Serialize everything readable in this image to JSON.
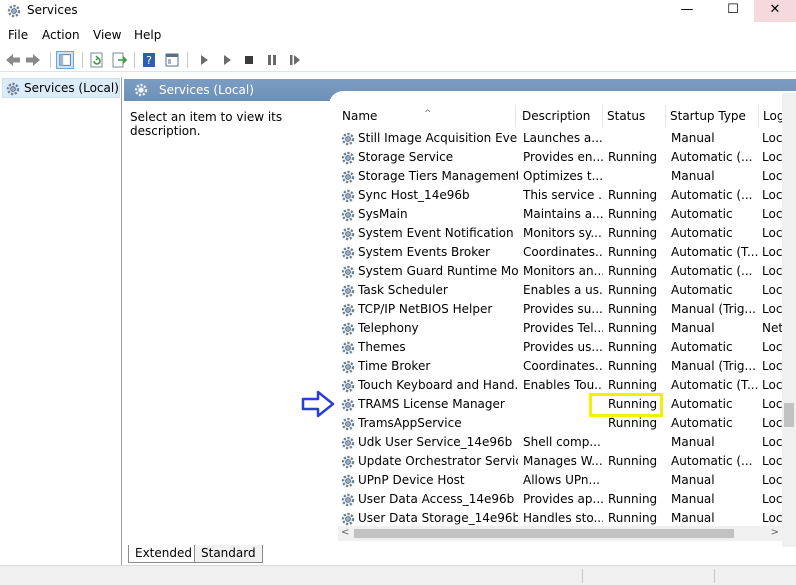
{
  "window": {
    "title": "Services",
    "minimize": "—",
    "maximize": "☐",
    "close": "✕"
  },
  "menu": [
    "File",
    "Action",
    "View",
    "Help"
  ],
  "tree": {
    "root": "Services (Local)"
  },
  "panel": {
    "title": "Services (Local)",
    "description_hint": "Select an item to view its description."
  },
  "columns": {
    "name": "Name",
    "description": "Description",
    "status": "Status",
    "startup": "Startup Type",
    "logon": "Log"
  },
  "services": [
    {
      "name": "Still Image Acquisition Events",
      "description": "Launches a...",
      "status": "",
      "startup": "Manual",
      "logon": "Loca"
    },
    {
      "name": "Storage Service",
      "description": "Provides en...",
      "status": "Running",
      "startup": "Automatic (...",
      "logon": "Loca"
    },
    {
      "name": "Storage Tiers Management",
      "description": "Optimizes t...",
      "status": "",
      "startup": "Manual",
      "logon": "Loca"
    },
    {
      "name": "Sync Host_14e96b",
      "description": "This service ...",
      "status": "Running",
      "startup": "Automatic (...",
      "logon": "Loca"
    },
    {
      "name": "SysMain",
      "description": "Maintains a...",
      "status": "Running",
      "startup": "Automatic",
      "logon": "Loca"
    },
    {
      "name": "System Event Notification S...",
      "description": "Monitors sy...",
      "status": "Running",
      "startup": "Automatic",
      "logon": "Loca"
    },
    {
      "name": "System Events Broker",
      "description": "Coordinates...",
      "status": "Running",
      "startup": "Automatic (T...",
      "logon": "Loca"
    },
    {
      "name": "System Guard Runtime Mo...",
      "description": "Monitors an...",
      "status": "Running",
      "startup": "Automatic (...",
      "logon": "Loca"
    },
    {
      "name": "Task Scheduler",
      "description": "Enables a us...",
      "status": "Running",
      "startup": "Automatic",
      "logon": "Loca"
    },
    {
      "name": "TCP/IP NetBIOS Helper",
      "description": "Provides su...",
      "status": "Running",
      "startup": "Manual (Trig...",
      "logon": "Loca"
    },
    {
      "name": "Telephony",
      "description": "Provides Tel...",
      "status": "Running",
      "startup": "Manual",
      "logon": "Netw"
    },
    {
      "name": "Themes",
      "description": "Provides us...",
      "status": "Running",
      "startup": "Automatic",
      "logon": "Loca"
    },
    {
      "name": "Time Broker",
      "description": "Coordinates...",
      "status": "Running",
      "startup": "Manual (Trig...",
      "logon": "Loca"
    },
    {
      "name": "Touch Keyboard and Hand...",
      "description": "Enables Tou...",
      "status": "Running",
      "startup": "Automatic (T...",
      "logon": "Loca"
    },
    {
      "name": "TRAMS License Manager",
      "description": "",
      "status": "Running",
      "startup": "Automatic",
      "logon": "Loca"
    },
    {
      "name": "TramsAppService",
      "description": "",
      "status": "Running",
      "startup": "Automatic",
      "logon": "Loca"
    },
    {
      "name": "Udk User Service_14e96b",
      "description": "Shell comp...",
      "status": "",
      "startup": "Manual",
      "logon": "Loca"
    },
    {
      "name": "Update Orchestrator Service",
      "description": "Manages W...",
      "status": "Running",
      "startup": "Automatic (...",
      "logon": "Loca"
    },
    {
      "name": "UPnP Device Host",
      "description": "Allows UPn...",
      "status": "",
      "startup": "Manual",
      "logon": "Loca"
    },
    {
      "name": "User Data Access_14e96b",
      "description": "Provides ap...",
      "status": "Running",
      "startup": "Manual",
      "logon": "Loca"
    },
    {
      "name": "User Data Storage_14e96b",
      "description": "Handles sto...",
      "status": "Running",
      "startup": "Manual",
      "logon": "Loca"
    }
  ],
  "tabs": [
    "Extended",
    "Standard"
  ],
  "colors": {
    "header_blue": "#7b9dc2",
    "annotation_arrow": "#2b3fd6",
    "annotation_box": "#f2f200"
  }
}
